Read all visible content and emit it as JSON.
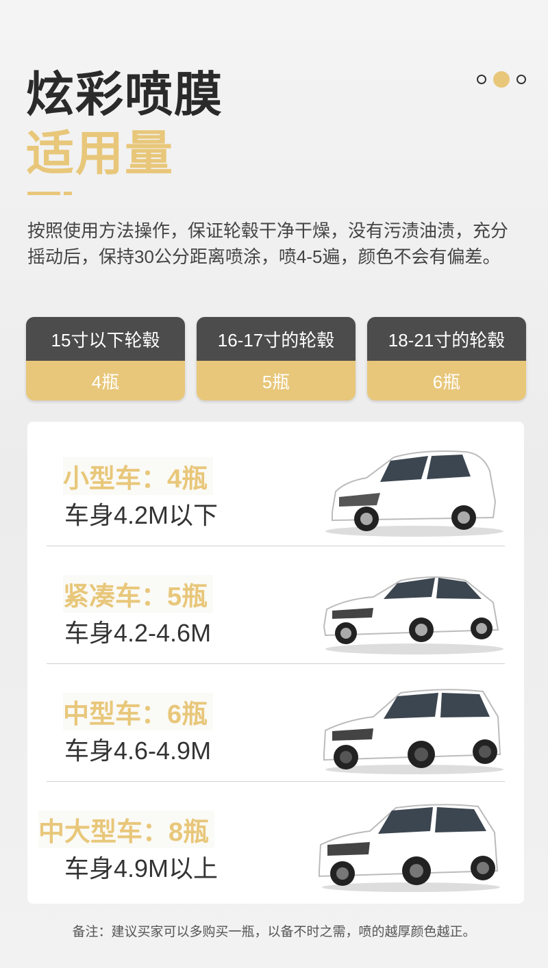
{
  "header": {
    "title_line1": "炫彩喷膜",
    "title_line2": "适用量"
  },
  "description": "按照使用方法操作，保证轮毂干净干燥，没有污渍油渍，充分摇动后，保持30公分距离喷涂，喷4-5遍，颜色不会有偏差。",
  "wheel_cards": [
    {
      "size": "15寸以下轮毂",
      "amount": "4瓶"
    },
    {
      "size": "16-17寸的轮毂",
      "amount": "5瓶"
    },
    {
      "size": "18-21寸的轮毂",
      "amount": "6瓶"
    }
  ],
  "car_types": [
    {
      "label": "小型车：4瓶",
      "body": "车身4.2M以下",
      "icon": "hatchback-car-image"
    },
    {
      "label": "紧凑车：5瓶",
      "body": "车身4.2-4.6M",
      "icon": "sedan-car-image"
    },
    {
      "label": "中型车：6瓶",
      "body": "车身4.6-4.9M",
      "icon": "suv-car-image"
    },
    {
      "label": "中大型车：8瓶",
      "body": "车身4.9M以上",
      "icon": "large-suv-car-image"
    }
  ],
  "note": "备注：建议买家可以多购买一瓶，以备不时之需，喷的越厚颜色越正。",
  "colors": {
    "accent": "#e8c77a",
    "dark": "#4c4c4c"
  }
}
